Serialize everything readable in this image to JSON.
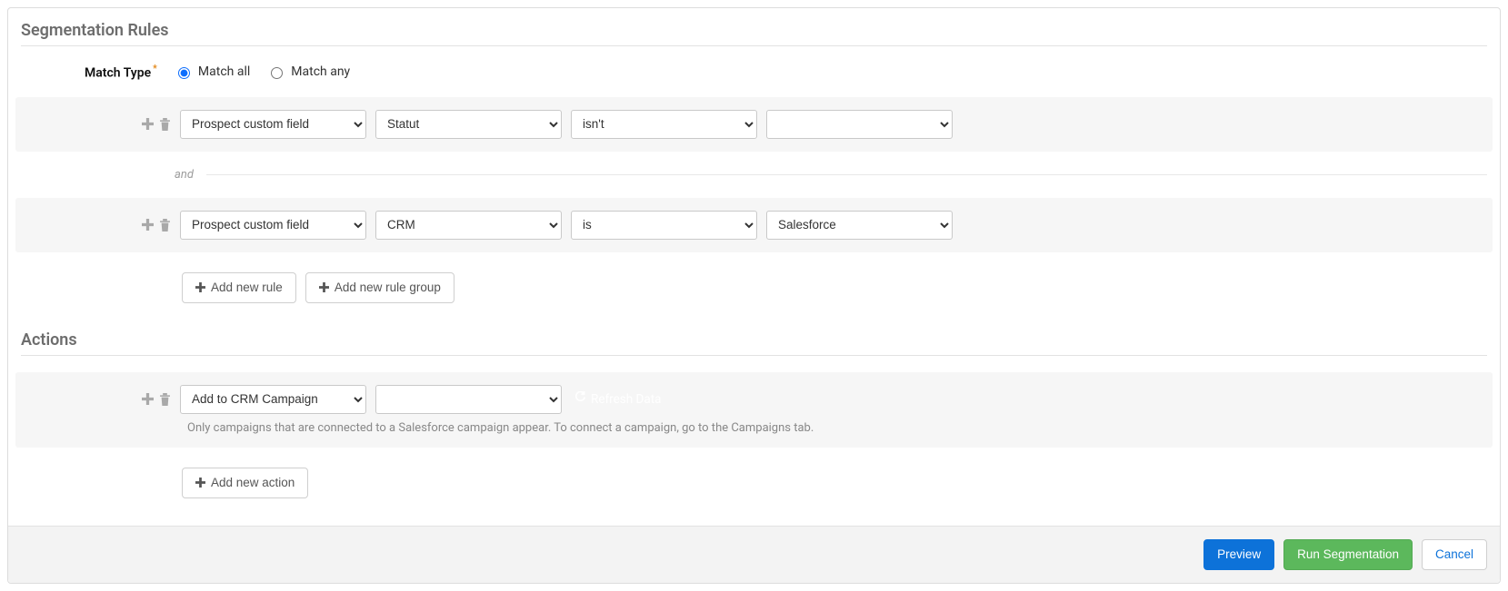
{
  "sections": {
    "segmentation_title": "Segmentation Rules",
    "actions_title": "Actions"
  },
  "match_type": {
    "label": "Match Type",
    "options": {
      "all": "Match all",
      "any": "Match any"
    },
    "selected": "all"
  },
  "rules": [
    {
      "field_type": "Prospect custom field",
      "field_name": "Statut",
      "operator": "isn't",
      "value": ""
    },
    {
      "field_type": "Prospect custom field",
      "field_name": "CRM",
      "operator": "is",
      "value": "Salesforce"
    }
  ],
  "connector": "and",
  "rule_buttons": {
    "add_rule": "Add new rule",
    "add_group": "Add new rule group"
  },
  "actions": [
    {
      "type": "Add to CRM Campaign",
      "value": "",
      "refresh_label": "Refresh Data"
    }
  ],
  "actions_help": "Only campaigns that are connected to a Salesforce campaign appear. To connect a campaign, go to the Campaigns tab.",
  "action_buttons": {
    "add_action": "Add new action"
  },
  "footer": {
    "preview": "Preview",
    "run": "Run Segmentation",
    "cancel": "Cancel"
  }
}
